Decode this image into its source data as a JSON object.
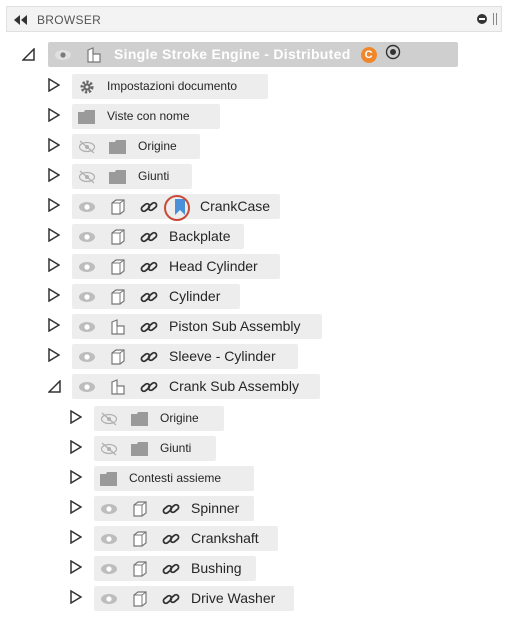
{
  "header": {
    "title": "BROWSER"
  },
  "root": {
    "label": "Single Stroke Engine - Distributed",
    "badge": "C"
  },
  "items": [
    {
      "label": "Impostazioni documento"
    },
    {
      "label": "Viste con nome"
    },
    {
      "label": "Origine"
    },
    {
      "label": "Giunti"
    },
    {
      "label": "CrankCase"
    },
    {
      "label": "Backplate"
    },
    {
      "label": "Head Cylinder"
    },
    {
      "label": "Cylinder"
    },
    {
      "label": "Piston Sub Assembly"
    },
    {
      "label": "Sleeve - Cylinder"
    },
    {
      "label": "Crank Sub Assembly"
    }
  ],
  "sub_items": [
    {
      "label": "Origine"
    },
    {
      "label": "Giunti"
    },
    {
      "label": "Contesti assieme"
    },
    {
      "label": "Spinner"
    },
    {
      "label": "Crankshaft"
    },
    {
      "label": "Bushing"
    },
    {
      "label": "Drive Washer"
    }
  ],
  "colors": {
    "highlight_ring": "#c84a36",
    "badge": "#f0882b",
    "bookmark": "#4a90d9"
  }
}
